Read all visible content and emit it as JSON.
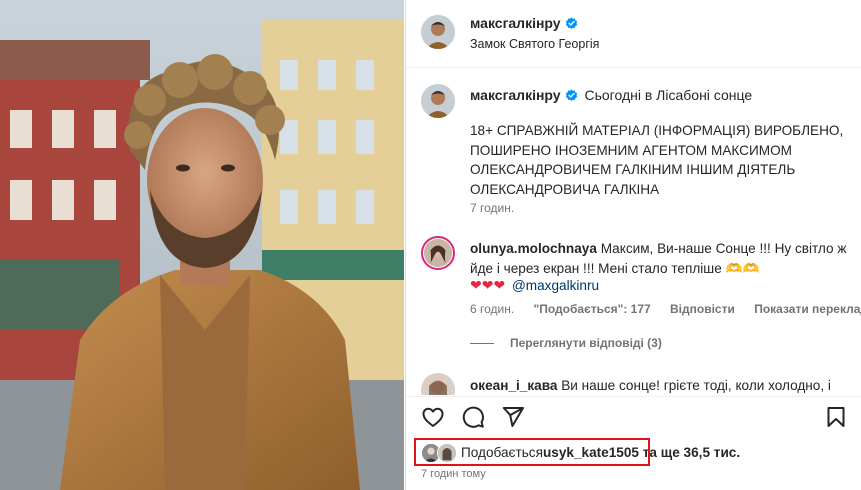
{
  "post_header": {
    "username": "максгалкінру",
    "location": "Замок Святого Георгія"
  },
  "caption": {
    "username": "максгалкінру",
    "title": "Сьогодні в Лісабоні сонце",
    "body": "18+ СПРАВЖНІЙ МАТЕРІАЛ (ІНФОРМАЦІЯ) ВИРОБЛЕНО, ПОШИРЕНО ІНОЗЕМНИМ АГЕНТОМ МАКСИМОМ ОЛЕКСАНДРОВИЧЕМ ГАЛКІНИМ ІНШИМ ДІЯТЕЛЬ ОЛЕКСАНДРОВИЧА ГАЛКІНА",
    "time": "7 годин."
  },
  "comments": [
    {
      "username": "olunya.molochnaya",
      "text": "Максим, Ви-наше Сонце !!! Ну світло ж йде і через екран !!! Мені стало тепліше 🫶🫶",
      "hearts": "❤❤❤",
      "mention": "@maxgalkinru",
      "time": "6 годин.",
      "likes": "\"Подобається\": 177",
      "reply": "Відповісти",
      "translate": "Показати переклад"
    },
    {
      "username": "океан_і_кава",
      "text": "Ви наше сонце! грієте тоді, коли холодно, і"
    }
  ],
  "view_replies": "Переглянути відповіді (3)",
  "likes_summary": {
    "prefix": "Подобається",
    "user": "usyk_kate1505",
    "suffix": " та ще 36,5 тис."
  },
  "post_time": "7 годин тому",
  "colors": {
    "verified": "#0095f6",
    "heart": "#e8263f",
    "mention": "#00376b",
    "highlight": "#e0111c",
    "muted": "#737373"
  },
  "icons": [
    "verified-icon",
    "heart-icon",
    "comment-icon",
    "share-icon",
    "bookmark-icon"
  ]
}
